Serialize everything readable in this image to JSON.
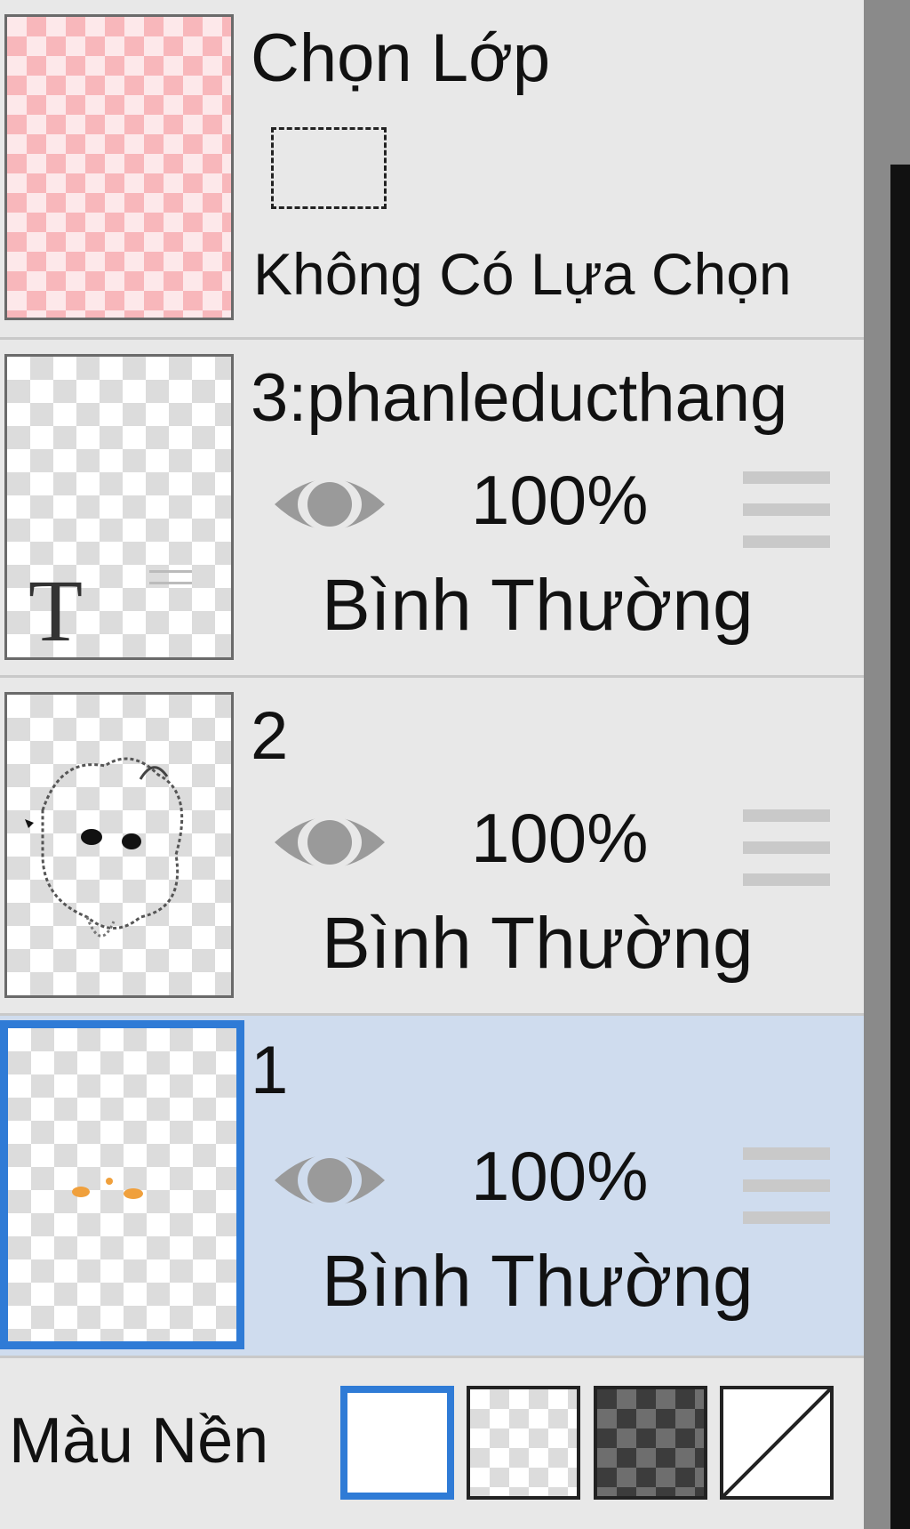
{
  "selection_layer": {
    "title": "Chọn Lớp",
    "status": "Không Có Lựa Chọn"
  },
  "layers": [
    {
      "name": "3:phanleducthang",
      "opacity": "100%",
      "blend": "Bình Thường",
      "thumb_glyph": "T",
      "visible_icon": "eye-icon"
    },
    {
      "name": "2",
      "opacity": "100%",
      "blend": "Bình Thường",
      "visible_icon": "eye-icon"
    },
    {
      "name": "1",
      "opacity": "100%",
      "blend": "Bình Thường",
      "visible_icon": "eye-icon",
      "selected": true
    }
  ],
  "background": {
    "label": "Màu Nền",
    "options": [
      "white",
      "transparent-light",
      "transparent-dark",
      "none"
    ],
    "selected": "white"
  },
  "colors": {
    "selection_blue": "#2f7bd6",
    "selected_row": "#cfdcee",
    "panel": "#e8e8e8"
  }
}
